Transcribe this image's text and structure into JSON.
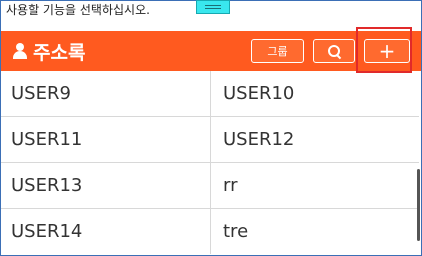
{
  "instruction": "사용할 기능을 선택하십시오.",
  "header": {
    "title": "주소록",
    "group_label": "그룹",
    "add_label": "+",
    "accent_color": "#ff5a1f"
  },
  "rows": [
    {
      "left": "USER9",
      "right": "USER10"
    },
    {
      "left": "USER11",
      "right": "USER12"
    },
    {
      "left": "USER13",
      "right": "rr"
    },
    {
      "left": "USER14",
      "right": "tre"
    }
  ]
}
